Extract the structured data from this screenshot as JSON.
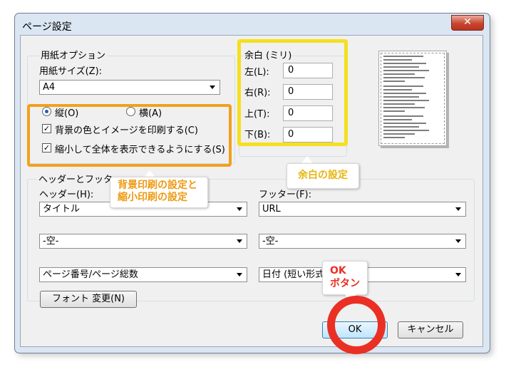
{
  "window": {
    "title": "ページ設定",
    "close_glyph": "✕"
  },
  "paper_options": {
    "group_label": "用紙オプション",
    "size_label": "用紙サイズ(Z):",
    "size_value": "A4",
    "portrait_label": "縦(O)",
    "landscape_label": "横(A)",
    "background_label": "背景の色とイメージを印刷する(C)",
    "background_checked": true,
    "shrink_label": "縮小して全体を表示できるようにする(S)",
    "shrink_checked": true,
    "check_glyph": "✓"
  },
  "margins": {
    "group_label": "余白 (ミリ)",
    "left_label": "左(L):",
    "left_value": "0",
    "right_label": "右(R):",
    "right_value": "0",
    "top_label": "上(T):",
    "top_value": "0",
    "bottom_label": "下(B):",
    "bottom_value": "0"
  },
  "header_footer": {
    "group_label": "ヘッダーとフッター",
    "header_label": "ヘッダー(H):",
    "footer_label": "フッター(F):",
    "header_values": [
      "タイトル",
      "-空-",
      "ページ番号/ページ総数"
    ],
    "footer_values": [
      "URL",
      "-空-",
      "日付 (短い形式)"
    ],
    "font_button": "フォント 変更(N)"
  },
  "buttons": {
    "ok": "OK",
    "cancel": "キャンセル"
  },
  "annotations": {
    "background_shrink_line1": "背景印刷の設定と",
    "background_shrink_line2": "縮小印刷の設定",
    "margin_note": "余白の設定",
    "ok_note_line1": "OK",
    "ok_note_line2": "ボタン"
  },
  "colors": {
    "orange_annotation": "#f0a11f",
    "yellow_annotation": "#f4e01e",
    "red_annotation": "#ea3024",
    "ok_button_highlight": "#ddeeff"
  }
}
